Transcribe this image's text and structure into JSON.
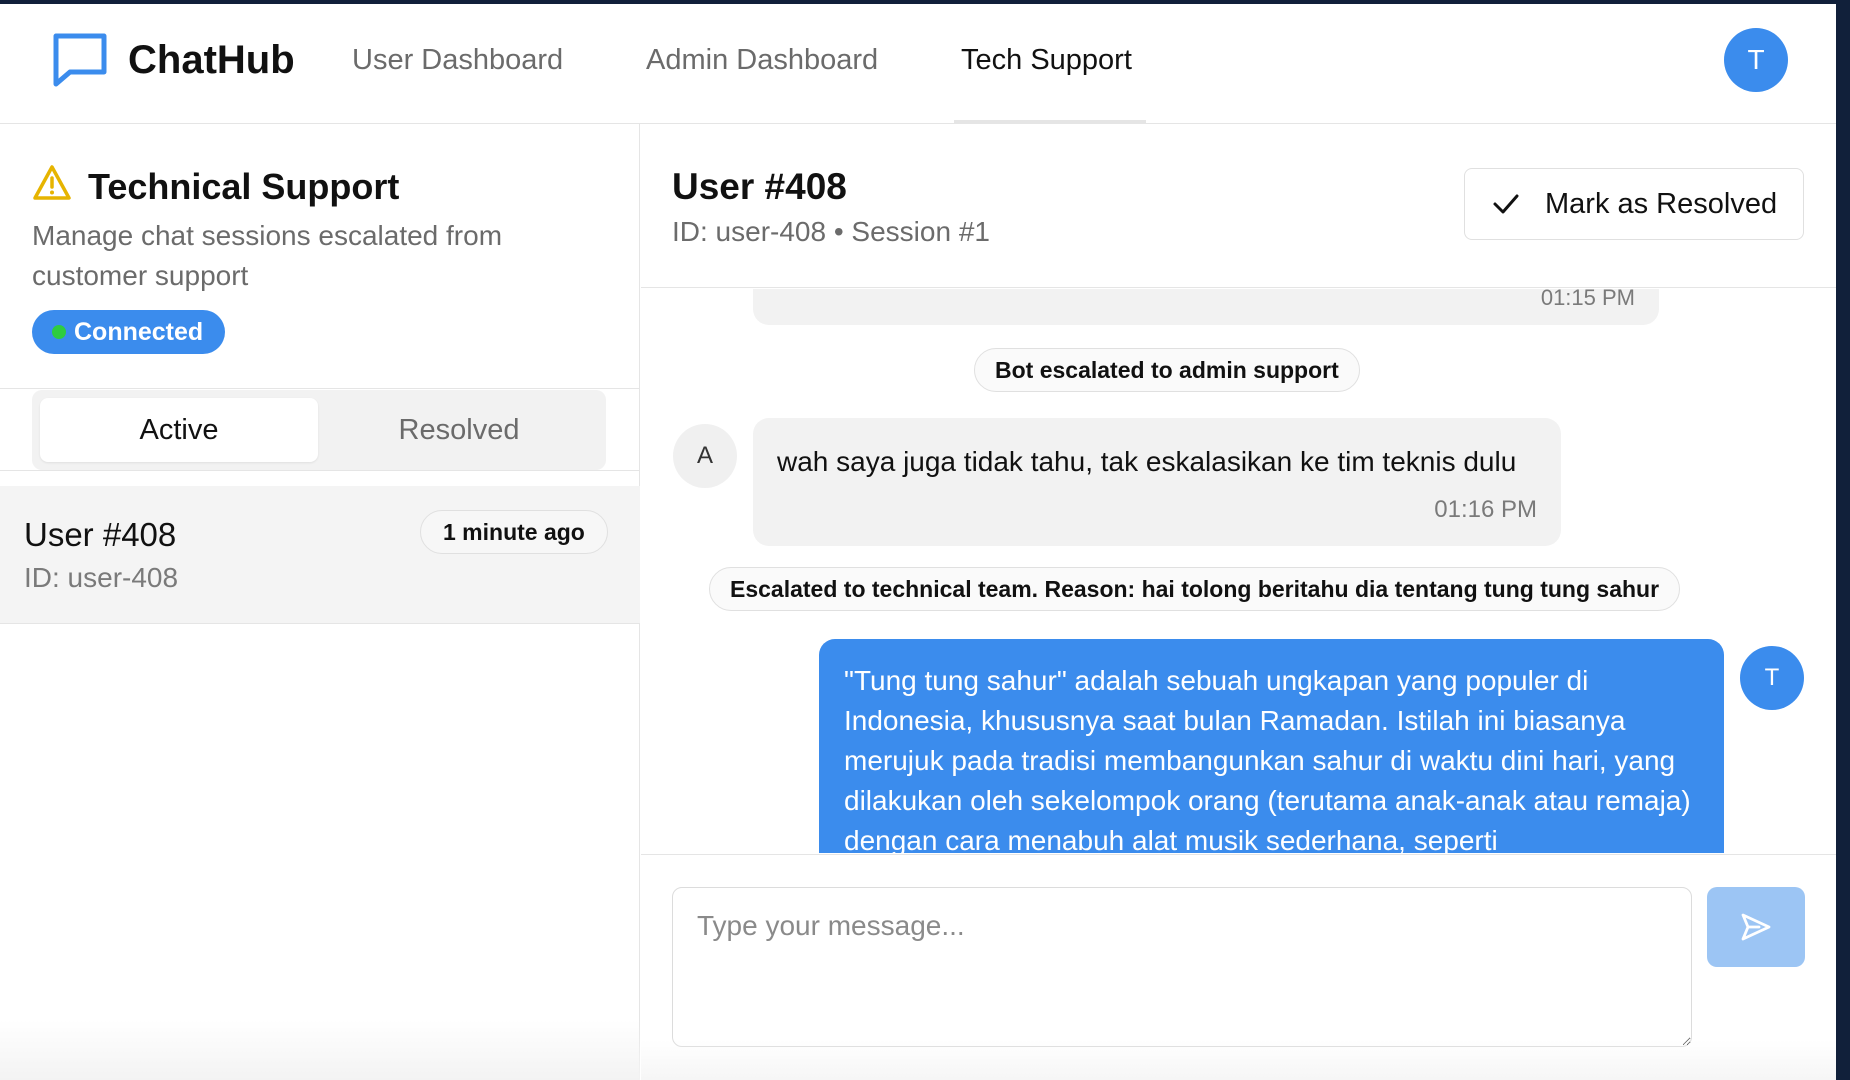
{
  "app": {
    "brand": "ChatHub",
    "user_avatar": "T"
  },
  "nav": {
    "items": [
      {
        "label": "User Dashboard"
      },
      {
        "label": "Admin Dashboard"
      },
      {
        "label": "Tech Support"
      }
    ],
    "active": "Tech Support"
  },
  "sidebar": {
    "title": "Technical Support",
    "description": "Manage chat sessions escalated from customer support",
    "status": "Connected",
    "tabs": [
      {
        "label": "Active"
      },
      {
        "label": "Resolved"
      }
    ],
    "active_tab": "Active",
    "sessions": [
      {
        "name": "User #408",
        "id": "ID: user-408",
        "time": "1 minute ago"
      }
    ]
  },
  "chat": {
    "title": "User #408",
    "subtitle": "ID: user-408 • Session #1",
    "resolve_label": "Mark as Resolved",
    "previous_time": "01:15 PM",
    "messages": [
      {
        "type": "system",
        "text": "Bot escalated to admin support"
      },
      {
        "type": "incoming",
        "avatar": "A",
        "text": "wah saya juga tidak tahu, tak eskalasikan ke tim teknis dulu",
        "time": "01:16 PM"
      },
      {
        "type": "system",
        "text": "Escalated to technical team. Reason: hai tolong beritahu dia tentang tung tung sahur"
      },
      {
        "type": "outgoing",
        "avatar": "T",
        "text": "\"Tung tung sahur\" adalah sebuah ungkapan yang populer di Indonesia, khususnya saat bulan Ramadan. Istilah ini biasanya merujuk pada tradisi membangunkan sahur di waktu dini hari, yang dilakukan oleh sekelompok orang (terutama anak-anak atau remaja) dengan cara menabuh alat musik sederhana, seperti"
      }
    ],
    "input_placeholder": "Type your message..."
  },
  "colors": {
    "accent": "#3b8ced",
    "accent_disabled": "#9cc5f4",
    "online": "#2ecc40",
    "warning": "#e6b400"
  },
  "icons": {
    "logo": "chat-bubble-icon",
    "warning": "warning-triangle-icon",
    "check": "check-icon",
    "send": "send-icon"
  }
}
